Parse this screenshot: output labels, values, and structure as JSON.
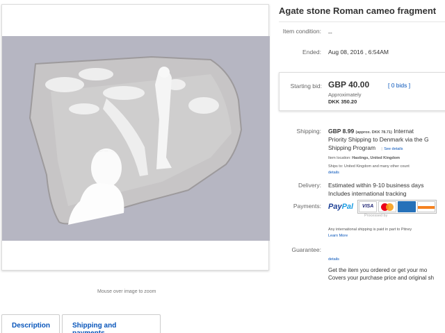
{
  "gallery": {
    "zoom_hint": "Mouse over image to zoom"
  },
  "tabs": [
    {
      "label": "Description"
    },
    {
      "label": "Shipping and payments"
    }
  ],
  "listing": {
    "title": "Agate stone Roman cameo fragment",
    "condition_label": "Item condition:",
    "condition_value": "--",
    "ended_label": "Ended:",
    "ended_value": "Aug 08, 2016 , 6:54AM"
  },
  "bid": {
    "label": "Starting bid:",
    "price": "GBP 40.00",
    "bids": "[ 0 bids ]",
    "approx": "Approximately",
    "dkk": "DKK 350.20"
  },
  "shipping": {
    "label": "Shipping:",
    "line1_price": "GBP 8.99",
    "line1_approx": "(approx. DKK 78.71)",
    "line1_rest": "Internat",
    "line2": "Priority Shipping to Denmark  via the G",
    "line3": "Shipping Program",
    "see_details": "See details",
    "location_label": "Item location:",
    "location_value": "Hastings, United Kingdom",
    "ships_to": "Ships to: United Kingdom and many other count",
    "details": "details"
  },
  "delivery": {
    "label": "Delivery:",
    "line1": "Estimated within 9-10 business days",
    "line2": "Includes international tracking"
  },
  "payments": {
    "label": "Payments:",
    "paypal_1": "Pay",
    "paypal_2": "Pal",
    "visa": "VISA",
    "processed": "Processed by",
    "intl_note": "Any international shipping is paid in part to Pitney",
    "learn_more": "Learn More"
  },
  "guarantee": {
    "label": "Guarantee:",
    "details": "details",
    "line1": "Get the item you ordered or get your mo",
    "line2": "Covers your purchase price and original sh"
  },
  "colors": {
    "link": "#0654ba",
    "paypal_dark": "#1c3f94",
    "paypal_light": "#1b9ce2"
  }
}
